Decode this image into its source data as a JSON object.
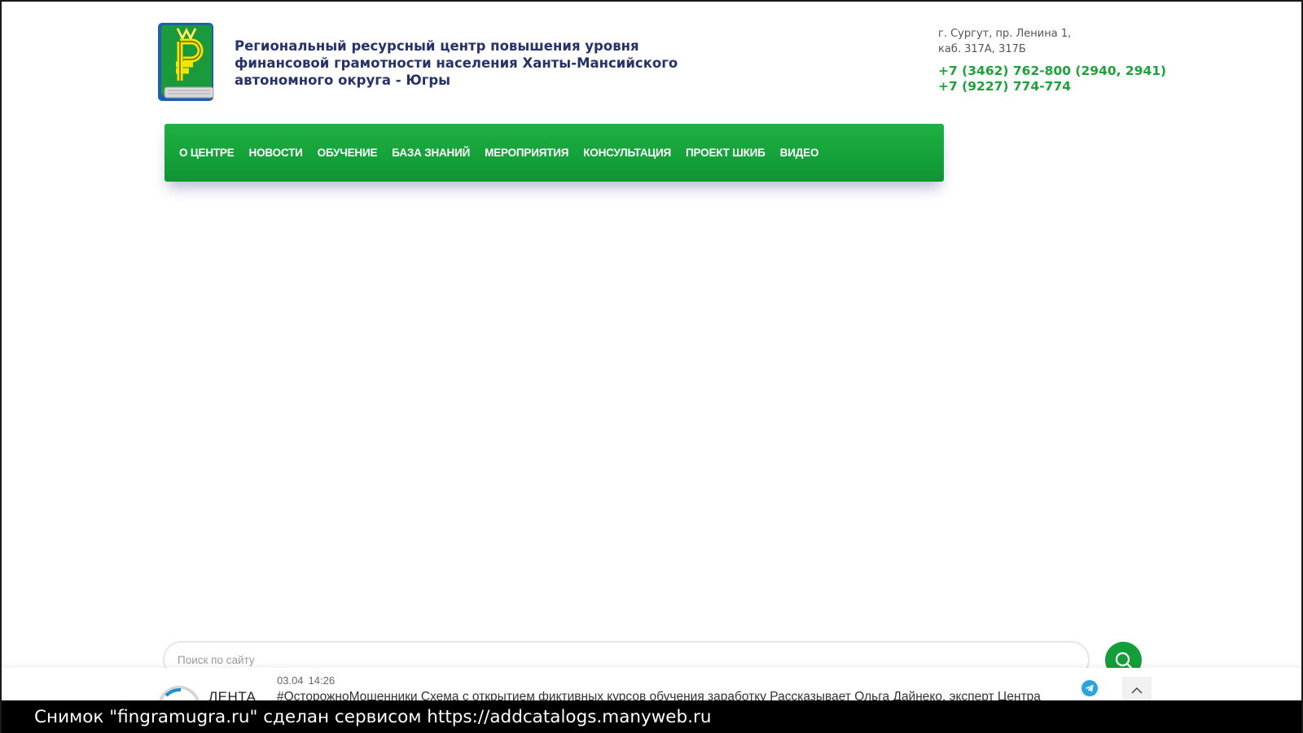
{
  "header": {
    "org_name_lines": [
      "Региональный ресурсный центр повышения уровня",
      "финансовой грамотности населения Ханты-Мансийского",
      "автономного округа - Югры"
    ],
    "address_lines": [
      "г. Сургут, пр. Ленина 1,",
      "каб. 317А, 317Б"
    ],
    "phones": [
      "+7 (3462) 762-800 (2940, 2941)",
      "+7 (9227) 774-774"
    ],
    "logo_icon": "ruble-book-logo",
    "phone_color": "#1ea23a",
    "title_color": "#26336b"
  },
  "nav": {
    "items": [
      "О ЦЕНТРЕ",
      "НОВОСТИ",
      "ОБУЧЕНИЕ",
      "БАЗА ЗНАНИЙ",
      "МЕРОПРИЯТИЯ",
      "КОНСУЛЬТАЦИЯ",
      "ПРОЕКТ ШКИБ",
      "ВИДЕО"
    ],
    "color": "#15a23a"
  },
  "search": {
    "placeholder": "Поиск по сайту",
    "button_icon": "search-icon"
  },
  "feed": {
    "logo_text": "ЛЕНТА",
    "date": "03.04",
    "time": "14:26",
    "text": "#ОсторожноМошенники Схема с открытием фиктивных курсов обучения заработку Рассказывает Ольга Дайнеко, эксперт Центра",
    "telegram_icon": "telegram-icon",
    "scroll_icon": "chevron-up-icon"
  },
  "caption": "Снимок \"fingramugra.ru\" сделан сервисом https://addcatalogs.manyweb.ru"
}
